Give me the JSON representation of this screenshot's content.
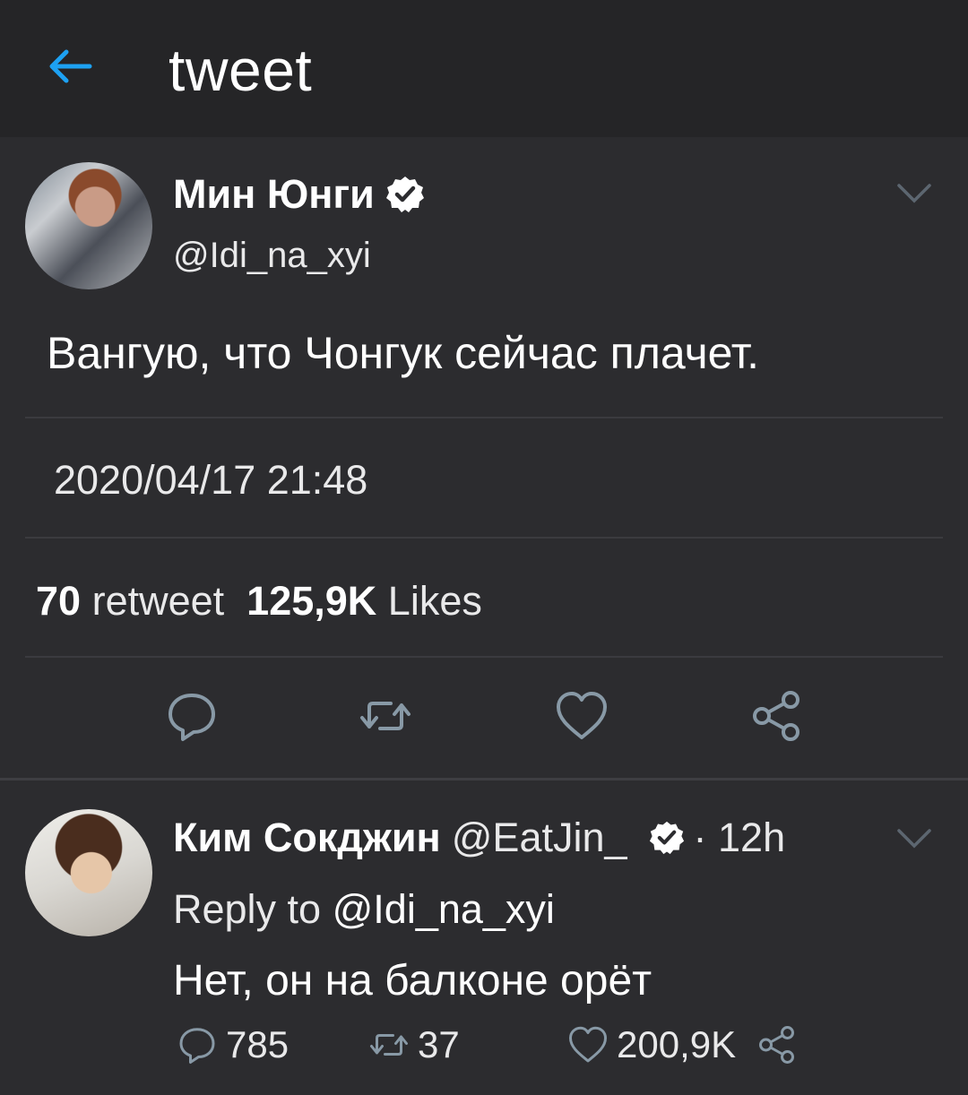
{
  "header": {
    "title": "tweet",
    "back_icon": "arrow-left-icon",
    "accent": "#1da1f2"
  },
  "tweet": {
    "display_name": "Мин Юнги",
    "handle": "@Idi_na_xyi",
    "verified": true,
    "text": "Вангую, что Чонгук сейчас плачет.",
    "timestamp": "2020/04/17 21:48",
    "retweet_count": "70",
    "retweet_label": "retweet",
    "likes_count": "125,9K",
    "likes_label": "Likes",
    "actions": [
      "reply-icon",
      "retweet-icon",
      "like-icon",
      "share-icon"
    ]
  },
  "reply": {
    "display_name": "Ким Сокджин",
    "handle": "@EatJin_",
    "verified": true,
    "time": "· 12h",
    "reply_to_label": "Reply to",
    "reply_to_handle": "@Idi_na_xyi",
    "text": "Нет, он на балконе орёт",
    "reply_count": "785",
    "retweet_count": "37",
    "like_count": "200,9K"
  },
  "colors": {
    "background": "#2c2c2f",
    "topbar": "#252527",
    "icon": "#8899a6",
    "verified_badge": "#ffffff"
  }
}
